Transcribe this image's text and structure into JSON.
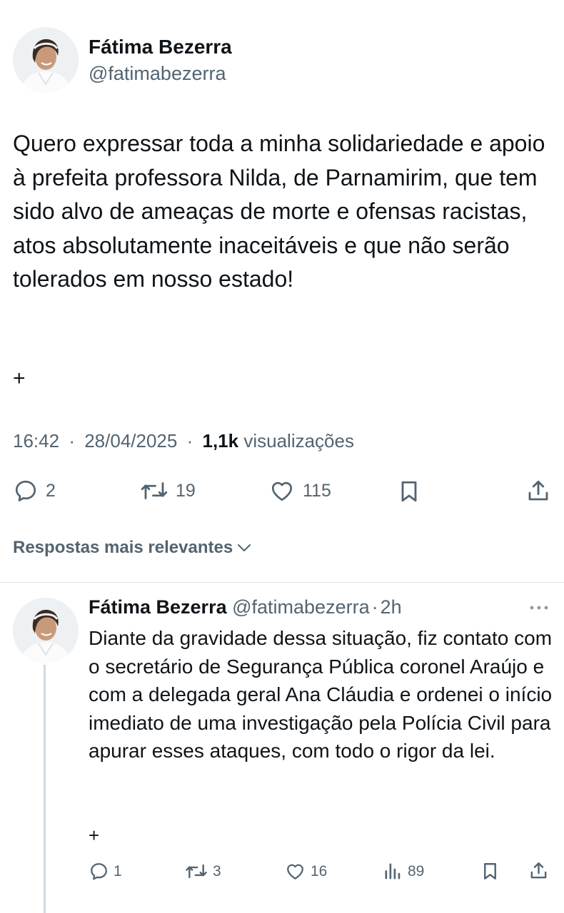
{
  "tweet": {
    "author_name": "Fátima Bezerra",
    "author_handle": "@fatimabezerra",
    "text": "Quero expressar toda a minha solidariedade e apoio à prefeita professora Nilda, de Parnamirim, que tem sido alvo de ameaças de morte e ofensas racistas, atos absolutamente inaceitáveis e que não serão tolerados em nosso estado!",
    "plus": "+",
    "time": "16:42",
    "date": "28/04/2025",
    "views_count": "1,1k",
    "views_label": "visualizações",
    "separator": "·",
    "actions": {
      "replies": "2",
      "reposts": "19",
      "likes": "115"
    }
  },
  "relevance_label": "Respostas mais relevantes",
  "reply": {
    "author_name": "Fátima Bezerra",
    "author_handle": "@fatimabezerra",
    "separator": "·",
    "time_ago": "2h",
    "text": "Diante da gravidade dessa situação, fiz contato com o secretário de Segurança Pública coronel Araújo e com a delegada geral Ana Cláudia e ordenei o início imediato de uma investigação pela Polícia Civil para apurar esses ataques, com todo o rigor da lei.",
    "plus": "+",
    "actions": {
      "replies": "1",
      "reposts": "3",
      "likes": "16",
      "views": "89"
    }
  },
  "colors": {
    "text": "#0f1419",
    "secondary": "#536471",
    "divider": "#e1e6ea",
    "thread_line": "#cfd9de"
  },
  "icons": [
    "reply-icon",
    "repost-icon",
    "like-icon",
    "bookmark-icon",
    "share-icon",
    "views-icon",
    "chevron-down-icon",
    "more-icon"
  ]
}
